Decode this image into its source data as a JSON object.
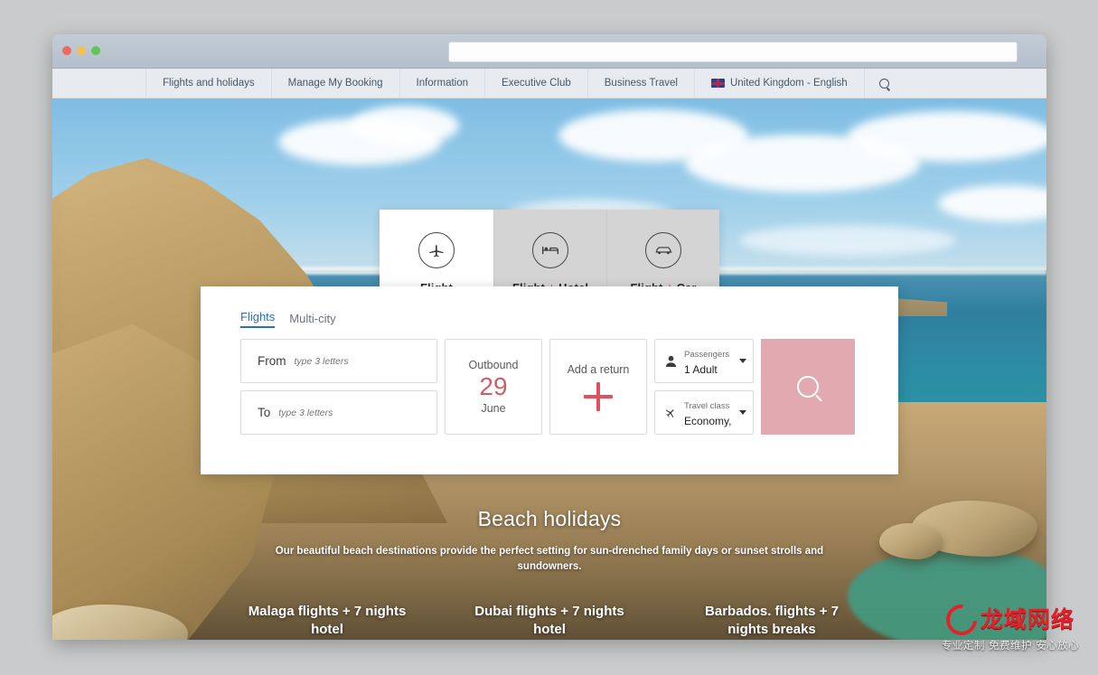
{
  "browser": {
    "traffic_lights": [
      "close",
      "minimize",
      "zoom"
    ],
    "url_value": "",
    "url_placeholder": ""
  },
  "sitenav": {
    "items": [
      {
        "label": "Flights and holidays",
        "icon": ""
      },
      {
        "label": "Manage My Booking",
        "icon": ""
      },
      {
        "label": "Information",
        "icon": ""
      },
      {
        "label": "Executive Club",
        "icon": ""
      },
      {
        "label": "Business Travel",
        "icon": ""
      }
    ],
    "locale": {
      "label": "United Kingdom - English",
      "icon": "uk-flag-icon"
    },
    "search": {
      "icon": "search-icon"
    }
  },
  "product_tabs": [
    {
      "label": "Flight",
      "label_suffix": "",
      "plus": "",
      "icon": "airplane-icon",
      "active": true
    },
    {
      "label": "Flight",
      "label_suffix": "Hotel",
      "plus": "+",
      "icon": "hotel-bed-icon",
      "active": false
    },
    {
      "label": "Flight",
      "label_suffix": "Car",
      "plus": "+",
      "icon": "car-icon",
      "active": false
    }
  ],
  "search_panel": {
    "tabs": [
      {
        "label": "Flights",
        "active": true
      },
      {
        "label": "Multi-city",
        "active": false
      }
    ],
    "from": {
      "label": "From",
      "value": "",
      "placeholder": "type 3 letters"
    },
    "to": {
      "label": "To",
      "value": "",
      "placeholder": "type 3 letters"
    },
    "outbound": {
      "label": "Outbound",
      "day": "29",
      "month": "June"
    },
    "add_return": {
      "label": "Add a return",
      "icon": "plus-icon"
    },
    "passengers": {
      "label": "Passengers",
      "value": "1 Adult",
      "icon": "person-icon",
      "caret": "chevron-down-icon"
    },
    "travel_class": {
      "label": "Travel class",
      "value": "Economy, U",
      "icon": "airplane-icon",
      "caret": "chevron-down-icon"
    },
    "search_button": {
      "icon": "search-icon",
      "label": ""
    }
  },
  "hero": {
    "title": "Beach holidays",
    "subtitle": "Our beautiful beach destinations provide the perfect setting for sun-drenched family days or sunset strolls and sundowners.",
    "promos": [
      {
        "label": "Malaga flights + 7 nights hotel"
      },
      {
        "label": "Dubai flights + 7 nights hotel"
      },
      {
        "label": "Barbados. flights + 7 nights breaks"
      }
    ]
  },
  "watermark": {
    "name": "龙域网络",
    "tagline": "专业定制 免费维护 安心放心"
  },
  "colors": {
    "accent_pink": "#e0aab0",
    "accent_red": "#e0505f",
    "date_red": "#c9606a",
    "link_blue": "#2d6fb3",
    "nav_bg": "#e7ebef",
    "watermark_red": "#e0232b"
  }
}
